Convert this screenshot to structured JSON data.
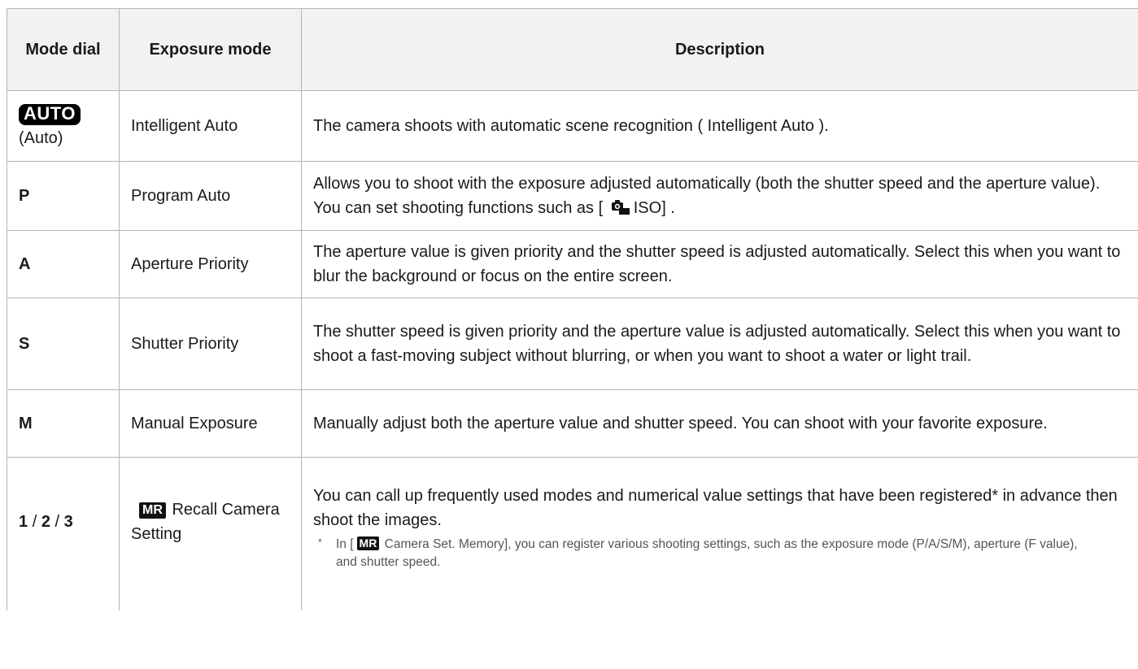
{
  "table": {
    "headers": {
      "mode_dial": "Mode dial",
      "exposure_mode": "Exposure mode",
      "description": "Description"
    },
    "rows": [
      {
        "dial_badge": "AUTO",
        "dial_sub": "(Auto)",
        "mode": "Intelligent Auto",
        "description": "The camera shoots with automatic scene recognition ( Intelligent Auto )."
      },
      {
        "dial": "P",
        "mode": "Program Auto",
        "description_pre": "Allows you to shoot with the exposure adjusted automatically (both the shutter speed and the aperture value). You can set shooting functions such as [",
        "description_icon": "camera-iso-icon",
        "description_post": "ISO] ."
      },
      {
        "dial": "A",
        "mode": "Aperture Priority",
        "description": "The aperture value is given priority and the shutter speed is adjusted automatically. Select this when you want to blur the background or focus on the entire screen."
      },
      {
        "dial": "S",
        "mode": "Shutter Priority",
        "description": "The shutter speed is given priority and the aperture value is adjusted automatically. Select this when you want to shoot a fast-moving subject without blurring, or when you want to shoot a water or light trail."
      },
      {
        "dial": "M",
        "mode": "Manual Exposure",
        "description": "Manually adjust both the aperture value and shutter speed. You can shoot with your favorite exposure."
      },
      {
        "dial_parts": [
          "1",
          "/",
          "2",
          "/",
          "3"
        ],
        "mode_badge": "MR",
        "mode": "Recall Camera Setting",
        "description": "You can call up frequently used modes and numerical value settings that have been registered* in advance then shoot the images.",
        "footnote_mark": "*",
        "footnote_pre": "In [",
        "footnote_badge": "MR",
        "footnote_post": "Camera Set. Memory], you can register various shooting settings, such as the exposure mode (P/A/S/M), aperture (F value), and shutter speed."
      }
    ]
  }
}
